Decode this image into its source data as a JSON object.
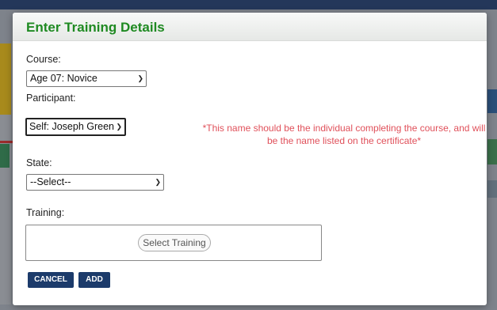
{
  "modal": {
    "title": "Enter Training Details",
    "course": {
      "label": "Course:",
      "selected": "Age 07: Novice"
    },
    "participant": {
      "label": "Participant:",
      "selected": "Self: Joseph Green"
    },
    "warning": "*This name should be the individual completing the course, and will be the name listed on the certificate*",
    "state": {
      "label": "State:",
      "selected": "--Select--"
    },
    "training": {
      "label": "Training:",
      "button": "Select Training"
    },
    "buttons": {
      "cancel": "CANCEL",
      "add": "ADD"
    }
  },
  "colors": {
    "title": "#1f8a22",
    "warning": "#e0505a",
    "button_bg": "#1c3b6b"
  }
}
